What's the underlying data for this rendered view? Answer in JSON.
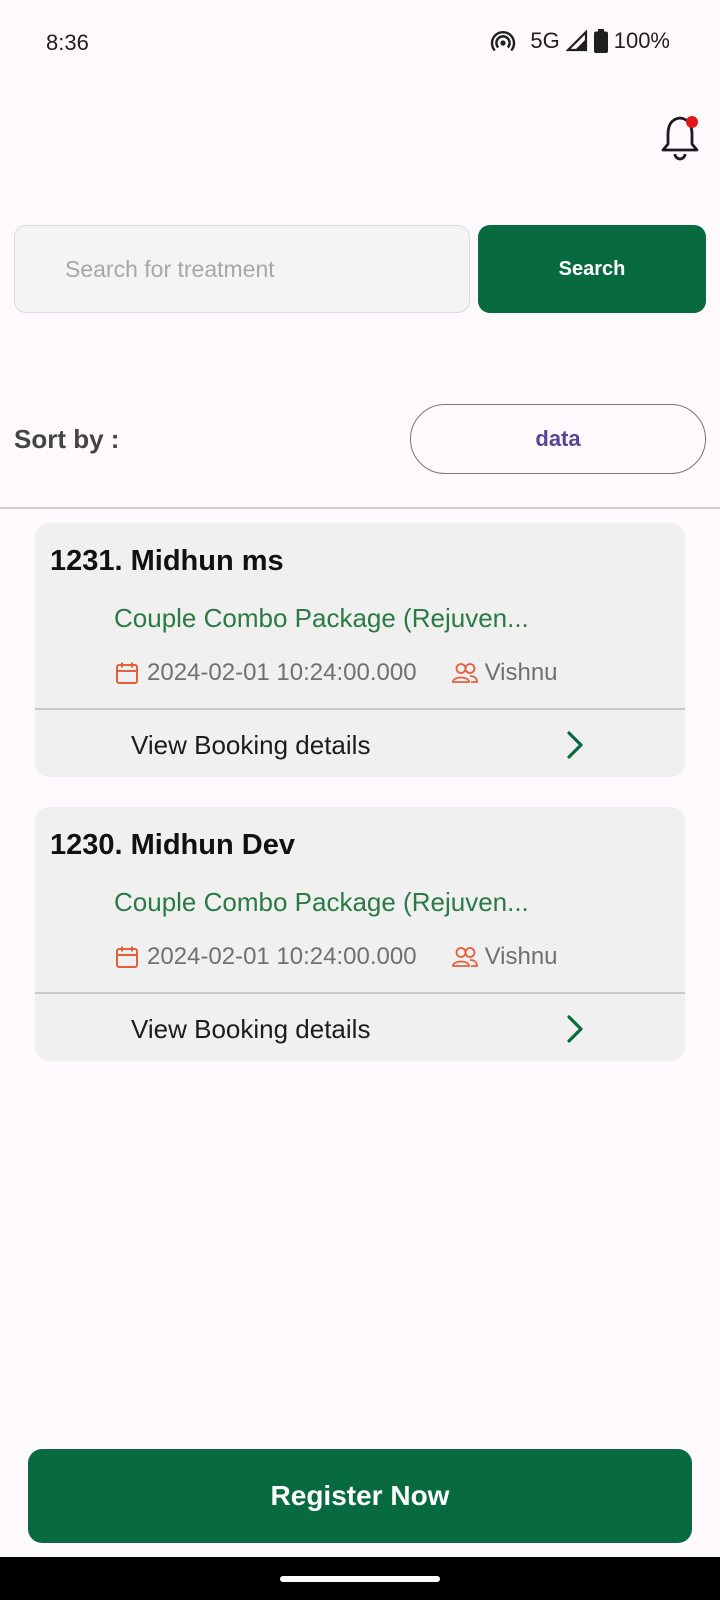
{
  "status_bar": {
    "time": "8:36",
    "network": "5G",
    "battery": "100%",
    "icons": [
      "hotspot-icon",
      "signal-icon",
      "battery-icon"
    ]
  },
  "header": {
    "notification_icon": "bell-icon",
    "has_unread": true
  },
  "search": {
    "placeholder": "Search for treatment",
    "value": "",
    "button_label": "Search"
  },
  "sort": {
    "label": "Sort by :",
    "selected": "data"
  },
  "bookings": [
    {
      "title": "1231. Midhun ms",
      "package": "Couple Combo Package (Rejuven...",
      "date": "2024-02-01 10:24:00.000",
      "staff": "Vishnu",
      "action_label": "View Booking details"
    },
    {
      "title": "1230. Midhun Dev",
      "package": "Couple Combo Package (Rejuven...",
      "date": "2024-02-01 10:24:00.000",
      "staff": "Vishnu",
      "action_label": "View Booking details"
    }
  ],
  "footer": {
    "register_label": "Register Now"
  },
  "colors": {
    "primary": "#086a3f",
    "package_text": "#2a7a44",
    "accent_icon": "#e5603a",
    "sort_text": "#5a4494",
    "notification_dot": "#e0161b"
  }
}
